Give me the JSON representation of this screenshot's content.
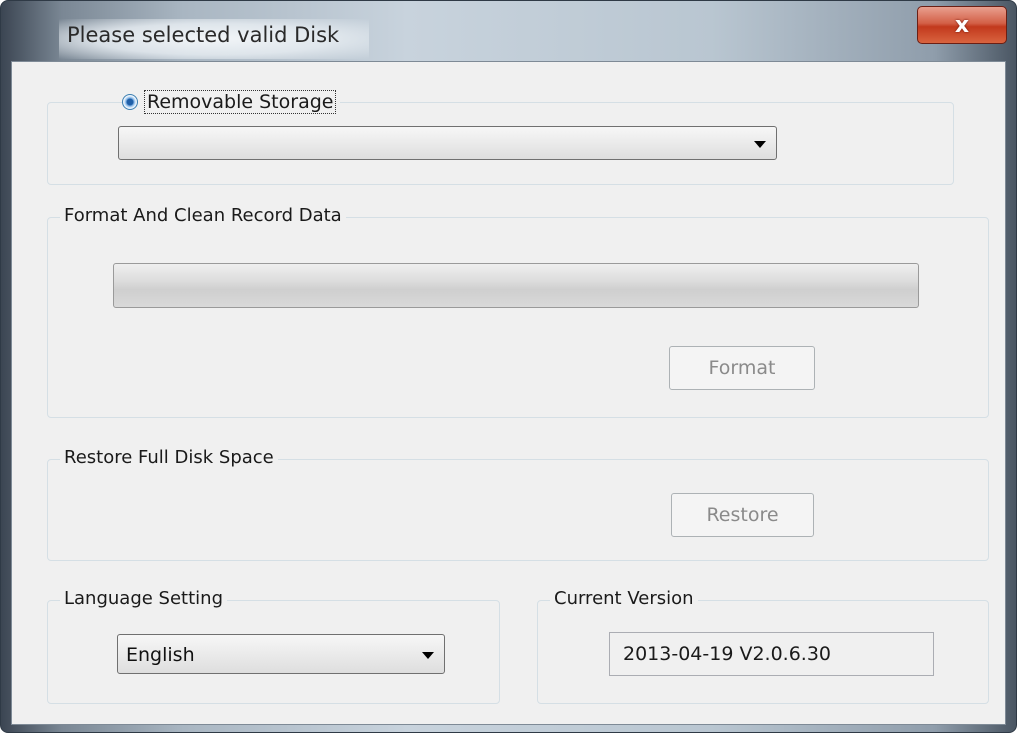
{
  "window": {
    "title": "Please selected valid Disk",
    "close_glyph": "x"
  },
  "storage": {
    "radio_label": "Removable Storage",
    "radio_selected": true,
    "selected_disk": ""
  },
  "format_group": {
    "legend": "Format And Clean Record Data",
    "progress": 0,
    "format_button": "Format"
  },
  "restore_group": {
    "legend": "Restore Full Disk Space",
    "restore_button": "Restore"
  },
  "language_group": {
    "legend": "Language Setting",
    "selected": "English"
  },
  "version_group": {
    "legend": "Current Version",
    "value": "2013-04-19 V2.0.6.30"
  },
  "icons": {
    "close": "close-icon",
    "dropdown": "chevron-down-icon"
  },
  "colors": {
    "close_button": "#c2391d",
    "radio_dot": "#1f5fa8"
  }
}
